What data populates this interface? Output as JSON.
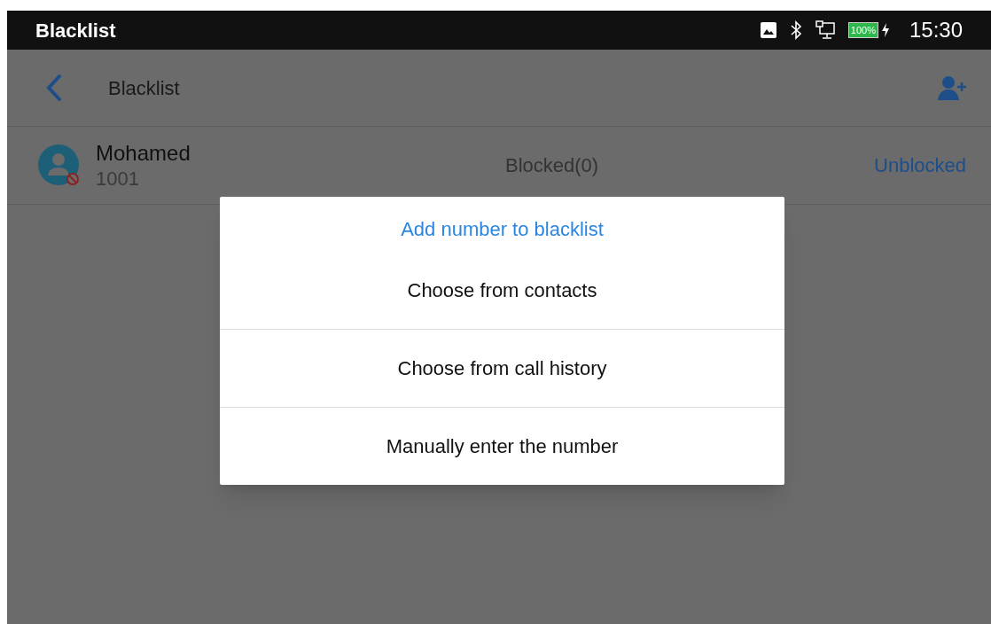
{
  "status_bar": {
    "title": "Blacklist",
    "battery": "100%",
    "time": "15:30"
  },
  "header": {
    "title": "Blacklist"
  },
  "entries": [
    {
      "name": "Mohamed",
      "number": "1001",
      "status": "Blocked(0)",
      "action": "Unblocked"
    }
  ],
  "dialog": {
    "title": "Add number to blacklist",
    "options": [
      "Choose from contacts",
      "Choose from call history",
      "Manually enter the number"
    ]
  }
}
